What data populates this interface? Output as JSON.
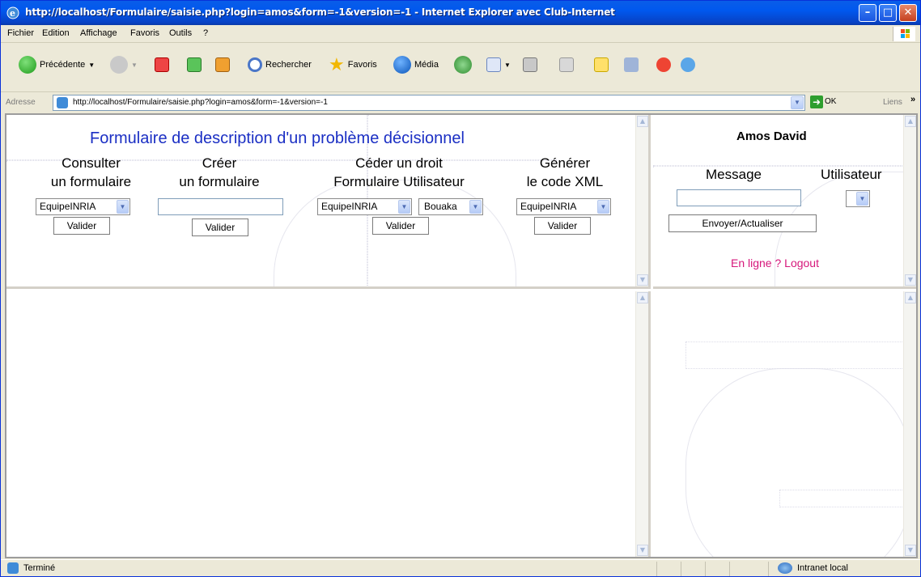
{
  "window": {
    "title": "http://localhost/Formulaire/saisie.php?login=amos&form=-1&version=-1 - Internet Explorer avec Club-Internet",
    "minimize": "–",
    "maximize": "□",
    "close": "✕"
  },
  "menu": [
    "Fichier",
    "Edition",
    "Affichage",
    "Favoris",
    "Outils",
    "?"
  ],
  "toolbar": {
    "back": "Précédente",
    "search": "Rechercher",
    "favorites": "Favoris",
    "media": "Média"
  },
  "address": {
    "label": "Adresse",
    "url": "http://localhost/Formulaire/saisie.php?login=amos&form=-1&version=-1",
    "go": "OK",
    "links": "Liens"
  },
  "form": {
    "title": "Formulaire de description d'un problème décisionnel",
    "consult": {
      "heading1": "Consulter",
      "heading2": "un formulaire",
      "select": "EquipeINRIA",
      "button": "Valider"
    },
    "create": {
      "heading1": "Créer",
      "heading2": "un formulaire",
      "input": "",
      "button": "Valider"
    },
    "cede": {
      "heading1": "Céder un droit",
      "heading2": "Formulaire Utilisateur",
      "select_form": "EquipeINRIA",
      "select_user": "Bouaka",
      "button": "Valider"
    },
    "generate": {
      "heading1": "Générer",
      "heading2": "le code XML",
      "select": "EquipeINRIA",
      "button": "Valider"
    }
  },
  "chat": {
    "user": "Amos David",
    "message_label": "Message",
    "user_label": "Utilisateur",
    "message_input": "",
    "user_select": "",
    "send_button": "Envoyer/Actualiser",
    "online_link": "En ligne ? Logout"
  },
  "status": {
    "text": "Terminé",
    "zone": "Intranet local"
  }
}
